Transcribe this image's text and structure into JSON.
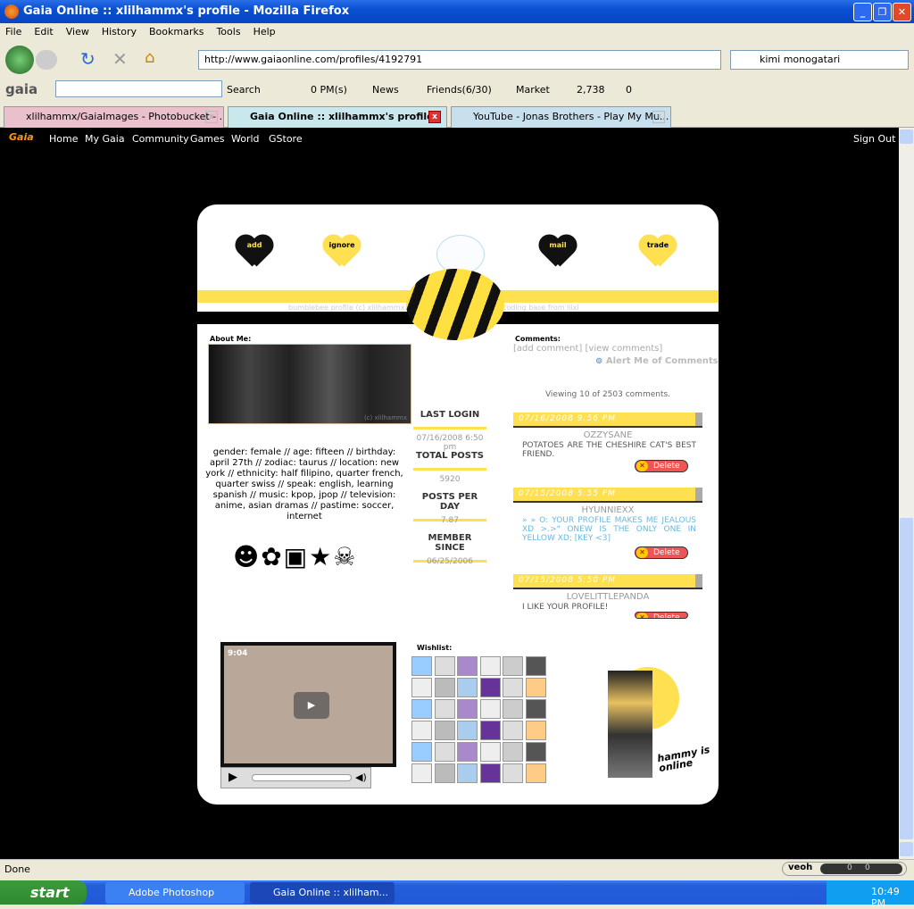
{
  "window": {
    "title": "Gaia Online :: xlilhammx's profile - Mozilla Firefox"
  },
  "menu": [
    "File",
    "Edit",
    "View",
    "History",
    "Bookmarks",
    "Tools",
    "Help"
  ],
  "nav": {
    "url": "http://www.gaiaonline.com/profiles/4192791",
    "search_value": "kimi monogatari"
  },
  "gaiatoolbar": {
    "logo": "gaia",
    "search_label": "Search",
    "pms": "0 PM(s)",
    "news": "News",
    "friends": "Friends(6/30)",
    "market": "Market",
    "gold": "2,738",
    "tickets": "0"
  },
  "tabs": [
    {
      "label": "xlilhammx/GaiaImages - Photobucket - ...",
      "active": false
    },
    {
      "label": "Gaia Online :: xlilhammx's profile",
      "active": true
    },
    {
      "label": "YouTube - Jonas Brothers - Play My Mu...",
      "active": false
    }
  ],
  "sitenav": {
    "logo": "Gaia",
    "items": [
      "Home",
      "My Gaia",
      "Community",
      "Games",
      "World",
      "GStore"
    ],
    "signout": "Sign Out"
  },
  "profile": {
    "buttons": [
      "add",
      "ignore",
      "mail",
      "trade"
    ],
    "credit_left": "bumblebee profile (c) xlilhammx",
    "credit_right": "coding base from liixi",
    "about_title": "About Me:",
    "photo_caption": "(c) xlilhammx",
    "about_text": "gender: female // age: fifteen // birthday: april 27th // zodiac: taurus // location: new york // ethnicity: half filipino, quarter french, quarter swiss // speak: english, learning spanish // music: kpop, jpop // television: anime, asian dramas // pastime: soccer, internet",
    "stats": [
      {
        "label": "LAST LOGIN",
        "value": "07/16/2008 6:50 pm"
      },
      {
        "label": "TOTAL POSTS",
        "value": "5920"
      },
      {
        "label": "POSTS PER DAY",
        "value": "7.87"
      },
      {
        "label": "MEMBER SINCE",
        "value": "06/25/2006"
      }
    ],
    "comments_title": "Comments:",
    "add_comment": "[add comment]",
    "view_comments": "[view comments]",
    "alert": "Alert Me of Comments",
    "viewing": "Viewing 10 of 2503 comments.",
    "comments": [
      {
        "date": "07/16/2008 9:56 PM",
        "user": "OZZYSANE",
        "text": "POTATOES ARE THE CHESHIRE CAT'S BEST FRIEND.",
        "delete": "Delete"
      },
      {
        "date": "07/15/2008 5:55 PM",
        "user": "HYUNNIEXX",
        "text": "» » O: YOUR PROFILE MAKES ME JEALOUS XD >.>\" ONEW IS THE ONLY ONE IN YELLOW XD; [KEY <3]",
        "delete": "Delete"
      },
      {
        "date": "07/15/2008 5:50 PM",
        "user": "LOVELITTLEPANDA",
        "text": "I LIKE YOUR PROFILE!",
        "delete": "Delete"
      }
    ],
    "video_overlay": "9:04",
    "wishlist_title": "Wishlist:",
    "avatar_text": "hammy is online",
    "colors": {
      "accent": "#ffe050",
      "comment_blue": "#6ab8e0"
    }
  },
  "status": {
    "text": "Done",
    "veoh": "veoh",
    "counts": [
      "0",
      "0"
    ]
  },
  "taskbar": {
    "start": "start",
    "tasks": [
      "Adobe Photoshop",
      "Gaia Online :: xlilham..."
    ],
    "clock": "10:49 PM"
  }
}
